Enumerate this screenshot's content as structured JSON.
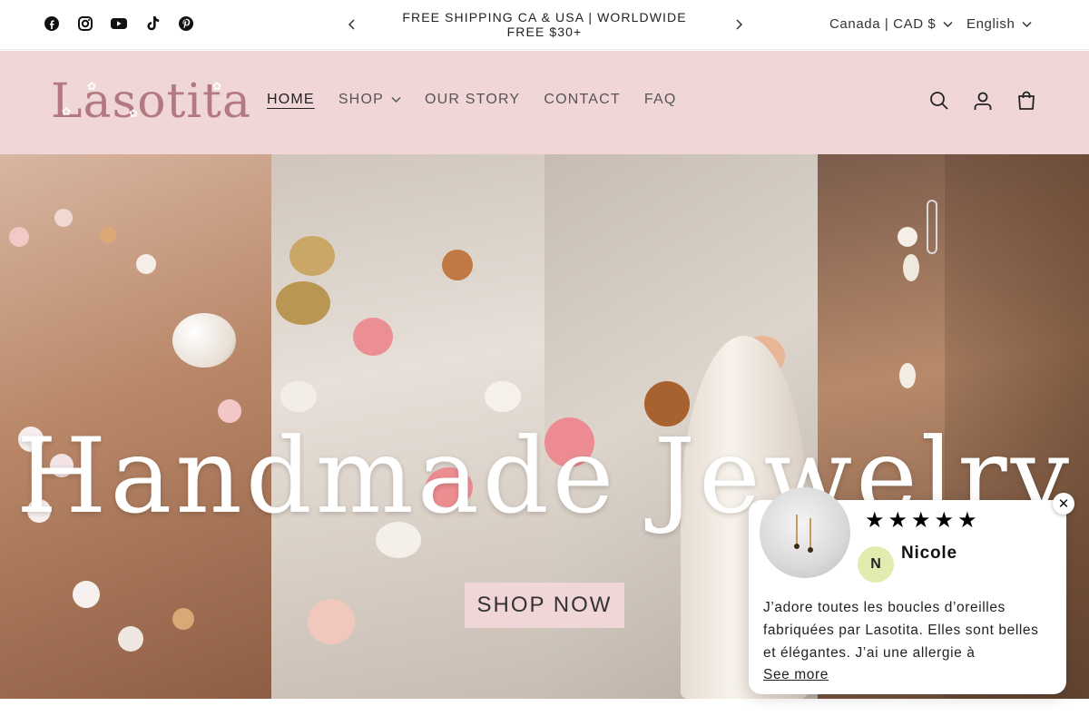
{
  "topbar": {
    "socials": [
      {
        "icon": "facebook-icon",
        "label": "f"
      },
      {
        "icon": "instagram-icon",
        "label": ""
      },
      {
        "icon": "youtube-icon",
        "label": ""
      },
      {
        "icon": "tiktok-icon",
        "label": ""
      },
      {
        "icon": "pinterest-icon",
        "label": ""
      }
    ],
    "announcement": "FREE SHIPPING CA & USA | WORLDWIDE FREE $30+",
    "country_selector": "Canada | CAD $",
    "language_selector": "English"
  },
  "header": {
    "logo_text": "Lasotita",
    "nav": [
      {
        "label": "HOME",
        "active": true
      },
      {
        "label": "SHOP",
        "has_dropdown": true
      },
      {
        "label": "OUR STORY"
      },
      {
        "label": "CONTACT"
      },
      {
        "label": "FAQ"
      }
    ],
    "icons": [
      "search-icon",
      "account-icon",
      "cart-icon"
    ],
    "brand_color": "#f1d6d8"
  },
  "hero": {
    "title": "Handmade Jewelry",
    "cta": "SHOP NOW"
  },
  "review": {
    "stars": 5,
    "star_glyph": "★",
    "avatar_initial": "N",
    "reviewer": "Nicole",
    "text": "J’adore toutes les boucles d’oreilles fabriquées par Lasotita. Elles sont belles et élégantes. J’ai une allergie à plusieurs…",
    "see_more": "See more",
    "close": "✕"
  }
}
